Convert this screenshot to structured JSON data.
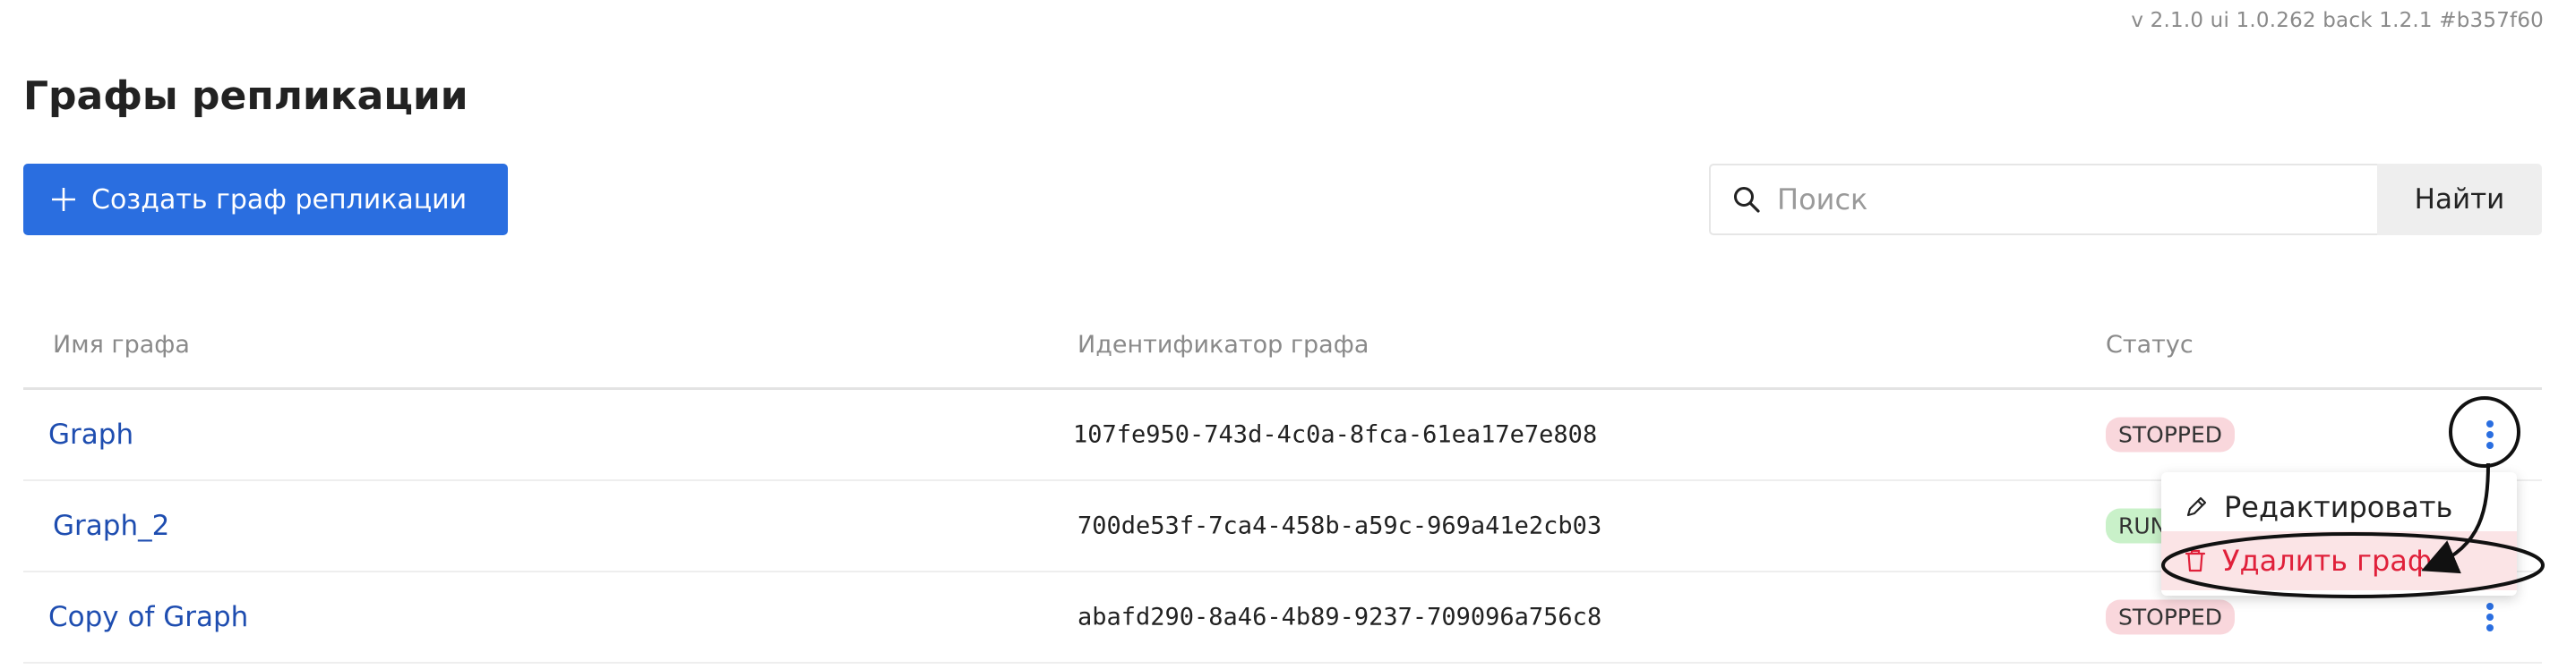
{
  "header": {
    "version": "v 2.1.0  ui 1.0.262  back 1.2.1  #b357f60",
    "title": "Графы репликации"
  },
  "toolbar": {
    "create_label": "Создать граф репликации",
    "search_placeholder": "Поиск",
    "search_value": "",
    "find_label": "Найти"
  },
  "table": {
    "columns": [
      "Имя графа",
      "Идентификатор графа",
      "Статус"
    ],
    "rows": [
      {
        "name": "Graph",
        "id": "107fe950-743d-4c0a-8fca-61ea17e7e808",
        "status": "STOPPED"
      },
      {
        "name": "Graph_2",
        "id": "700de53f-7ca4-458b-a59c-969a41e2cb03",
        "status": "RUNNING"
      },
      {
        "name": "Copy of Graph",
        "id": "abafd290-8a46-4b89-9237-709096a756c8",
        "status": "STOPPED"
      }
    ]
  },
  "context_menu": {
    "edit_label": "Редактировать",
    "delete_label": "Удалить граф"
  },
  "colors": {
    "accent": "#2a6ee0",
    "link": "#1e4db0",
    "danger": "#e0203a",
    "stopped_badge": "#f9d7dc",
    "running_badge": "#c9f1c9"
  },
  "icons": [
    "plus-icon",
    "search-icon",
    "kebab-icon",
    "pencil-icon",
    "trash-icon"
  ]
}
